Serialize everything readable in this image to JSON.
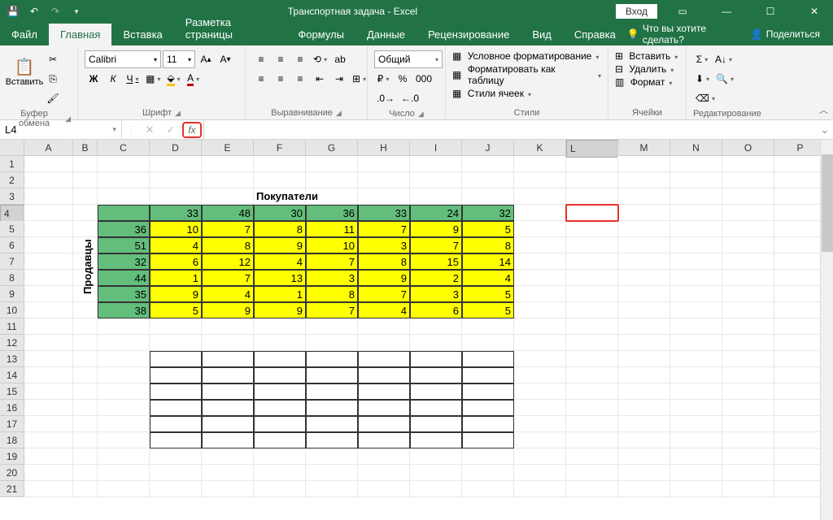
{
  "titlebar": {
    "title": "Транспортная задача  -  Excel",
    "login": "Вход"
  },
  "tabs": {
    "file": "Файл",
    "home": "Главная",
    "insert": "Вставка",
    "pagelayout": "Разметка страницы",
    "formulas": "Формулы",
    "data": "Данные",
    "review": "Рецензирование",
    "view": "Вид",
    "help": "Справка",
    "tellme": "Что вы хотите сделать?",
    "share": "Поделиться"
  },
  "ribbon": {
    "clipboard": {
      "paste": "Вставить",
      "label": "Буфер обмена"
    },
    "font": {
      "name": "Calibri",
      "size": "11",
      "label": "Шрифт",
      "bold": "Ж",
      "italic": "К",
      "underline": "Ч"
    },
    "align": {
      "label": "Выравнивание"
    },
    "number": {
      "format": "Общий",
      "label": "Число"
    },
    "styles": {
      "cond": "Условное форматирование",
      "fmttable": "Форматировать как таблицу",
      "cellstyles": "Стили ячеек",
      "label": "Стили"
    },
    "cells": {
      "insert": "Вставить",
      "delete": "Удалить",
      "format": "Формат",
      "label": "Ячейки"
    },
    "editing": {
      "label": "Редактирование"
    }
  },
  "formula": {
    "namebox": "L4",
    "fx": "fx"
  },
  "columns": [
    "A",
    "B",
    "C",
    "D",
    "E",
    "F",
    "G",
    "H",
    "I",
    "J",
    "K",
    "L",
    "M",
    "N",
    "O",
    "P"
  ],
  "colwidths": {
    "A": 60,
    "B": 30,
    "C": 64,
    "D": 64,
    "E": 64,
    "F": 64,
    "G": 64,
    "H": 64,
    "I": 64,
    "J": 64,
    "K": 64,
    "L": 64,
    "M": 64,
    "N": 64,
    "O": 64,
    "P": 64
  },
  "rows": 21,
  "labels": {
    "buyers": "Покупатели",
    "sellers": "Продавцы"
  },
  "table": {
    "header": [
      "",
      33,
      48,
      30,
      36,
      33,
      24,
      32
    ],
    "body": [
      [
        36,
        10,
        7,
        8,
        11,
        7,
        9,
        5
      ],
      [
        51,
        4,
        8,
        9,
        10,
        3,
        7,
        8
      ],
      [
        32,
        6,
        12,
        4,
        7,
        8,
        15,
        14
      ],
      [
        44,
        1,
        7,
        13,
        3,
        9,
        2,
        4
      ],
      [
        35,
        9,
        4,
        1,
        8,
        7,
        3,
        5
      ],
      [
        38,
        5,
        9,
        9,
        7,
        4,
        6,
        5
      ]
    ]
  },
  "emptygrid": {
    "startRow": 13,
    "endRow": 18,
    "startCol": "D",
    "endCol": "J"
  },
  "selection": {
    "row": 4,
    "col": "L"
  },
  "colors": {
    "excel_green": "#217346"
  }
}
